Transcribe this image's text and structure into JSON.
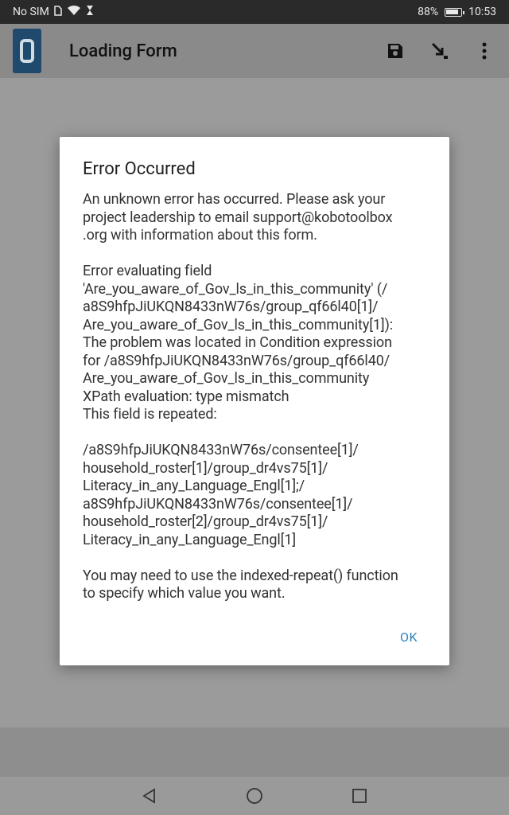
{
  "status_bar": {
    "carrier": "No SIM",
    "battery_percent": "88%",
    "battery_level": 0.88,
    "time": "10:53"
  },
  "app_bar": {
    "title": "Loading Form",
    "icons": [
      "app-logo-icon",
      "save-icon",
      "jump-arrow-icon",
      "more-vert-icon"
    ]
  },
  "dialog": {
    "title": "Error Occurred",
    "message": "An unknown error has occurred. Please ask your\nproject leadership to email support@kobotoolbox\n.org with information about this form.\n\nError evaluating field\n'Are_you_aware_of_Gov_ls_in_this_community' (/\na8S9hfpJiUKQN8433nW76s/group_qf66l40[1]/\nAre_you_aware_of_Gov_ls_in_this_community[1]):\nThe problem was located in Condition expression\nfor /a8S9hfpJiUKQN8433nW76s/group_qf66l40/\nAre_you_aware_of_Gov_ls_in_this_community\nXPath evaluation: type mismatch\nThis field is repeated:\n\n/a8S9hfpJiUKQN8433nW76s/consentee[1]/\nhousehold_roster[1]/group_dr4vs75[1]/\nLiteracy_in_any_Language_Engl[1];/\na8S9hfpJiUKQN8433nW76s/consentee[1]/\nhousehold_roster[2]/group_dr4vs75[1]/\nLiteracy_in_any_Language_Engl[1]\n\nYou may need to use the indexed-repeat() function\nto specify which value you want.",
    "ok_label": "OK"
  },
  "nav_bar": {
    "icons": [
      "back-triangle-icon",
      "home-circle-icon",
      "recents-square-icon"
    ]
  },
  "colors": {
    "accent": "#2a82c2",
    "status_bar": "#2a2a2a",
    "scrim": "#9b9b9b",
    "logo": "#1f4a6d"
  }
}
